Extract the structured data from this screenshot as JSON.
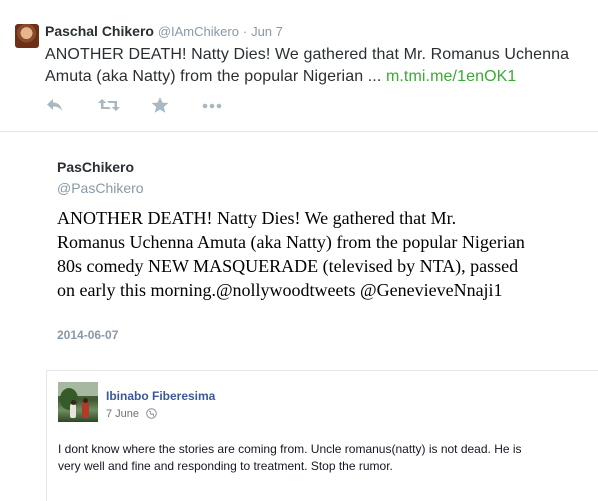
{
  "tweet": {
    "author_name": "Paschal Chikero",
    "handle": "@IAmChikero",
    "separator": "·",
    "date": "Jun 7",
    "text": "ANOTHER DEATH! Natty Dies! We gathered that Mr. Romanus Uchenna Amuta (aka Natty) from the popular Nigerian ...",
    "link": "m.tmi.me/1enOK1",
    "actions": [
      "reply-icon",
      "retweet-icon",
      "favorite-icon",
      "more-icon"
    ]
  },
  "embed": {
    "name": "PasChikero",
    "handle": "@PasChikero",
    "text": "ANOTHER DEATH! Natty Dies! We gathered that Mr. Romanus Uchenna Amuta (aka Natty) from the popular Nigerian 80s comedy NEW MASQUERADE (televised by NTA), passed on early this morning.@nollywoodtweets @GenevieveNnaji1",
    "date": "2014-06-07"
  },
  "comment": {
    "name": "Ibinabo Fiberesima",
    "date": "7 June",
    "privacy_icon": "globe-icon",
    "text": "I dont know where the stories are coming from. Uncle romanus(natty) is not dead. He is very well and fine and responding to treatment. Stop the rumor."
  },
  "colors": {
    "link_green": "#3aaa35",
    "facebook_blue": "#3b5998",
    "muted_gray": "#8899a6"
  }
}
